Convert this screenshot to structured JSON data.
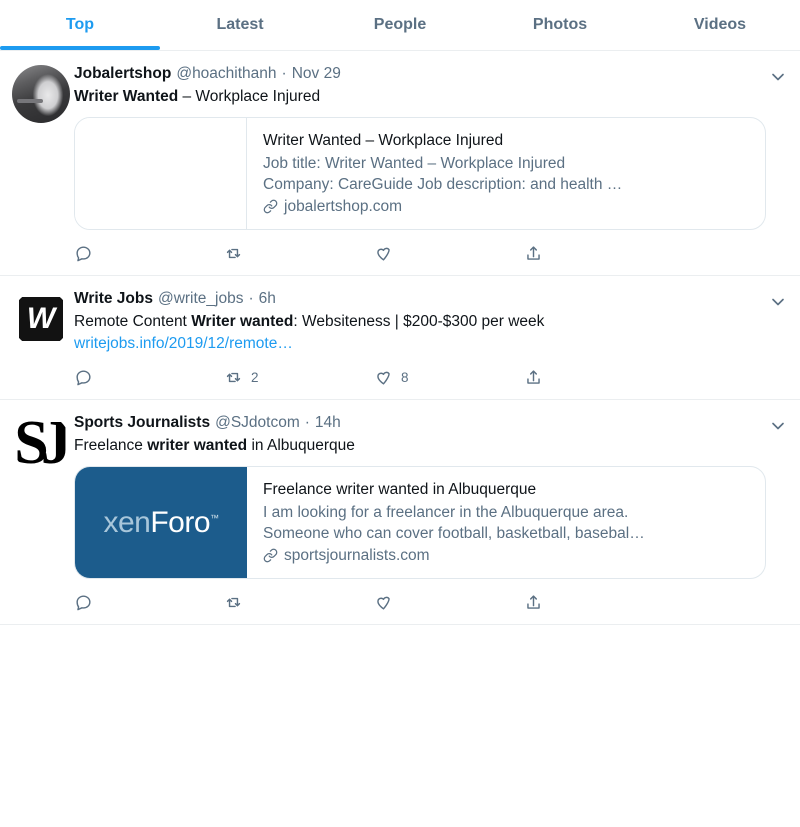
{
  "tabs": [
    {
      "label": "Top",
      "active": true
    },
    {
      "label": "Latest",
      "active": false
    },
    {
      "label": "People",
      "active": false
    },
    {
      "label": "Photos",
      "active": false
    },
    {
      "label": "Videos",
      "active": false
    }
  ],
  "colors": {
    "accent": "#1d9bf0",
    "muted": "#5b7083",
    "text": "#0f1419",
    "border": "#ebeef0",
    "card_border": "#e1e8ed",
    "xenforo_blue": "#1c5c8c"
  },
  "tweets": [
    {
      "display_name": "Jobalertshop",
      "handle": "@hoachithanh",
      "separator": "·",
      "time": "Nov 29",
      "text_bold": "Writer Wanted",
      "text_rest": " – Workplace Injured",
      "avatar": "photo-bride-avatar",
      "card": {
        "title": "Writer Wanted – Workplace Injured",
        "description_line1": "Job title: Writer Wanted – Workplace Injured",
        "description_line2": "Company: CareGuide Job description: and health …",
        "domain": "jobalertshop.com",
        "thumb_kind": "blank"
      },
      "actions": {
        "reply_count": "",
        "retweet_count": "",
        "like_count": "",
        "share_count": ""
      }
    },
    {
      "display_name": "Write Jobs",
      "handle": "@write_jobs",
      "separator": "·",
      "time": "6h",
      "text_pre": "Remote Content ",
      "text_bold": "Writer wanted",
      "text_rest": ": Websiteness | $200-$300 per week",
      "link": "writejobs.info/2019/12/remote…",
      "avatar": "w-logo-avatar",
      "actions": {
        "reply_count": "",
        "retweet_count": "2",
        "like_count": "8",
        "share_count": ""
      }
    },
    {
      "display_name": "Sports Journalists",
      "handle": "@SJdotcom",
      "separator": "·",
      "time": "14h",
      "text_pre": "Freelance ",
      "text_bold": "writer wanted",
      "text_rest": " in Albuquerque",
      "avatar": "sj-monogram-avatar",
      "card": {
        "title": "Freelance writer wanted in Albuquerque",
        "description_line1": "I am looking for a freelancer in the Albuquerque area.",
        "description_line2": "Someone who can cover football, basketball, basebal…",
        "domain": "sportsjournalists.com",
        "thumb_kind": "xenforo",
        "thumb_logo_part1": "xen",
        "thumb_logo_part2": "Foro",
        "thumb_logo_tm": "™"
      },
      "actions": {
        "reply_count": "",
        "retweet_count": "",
        "like_count": "",
        "share_count": ""
      }
    }
  ],
  "icons": {
    "reply": "reply-icon",
    "retweet": "retweet-icon",
    "like": "like-icon",
    "share": "share-icon",
    "caret": "chevron-down-icon",
    "link": "link-icon"
  }
}
